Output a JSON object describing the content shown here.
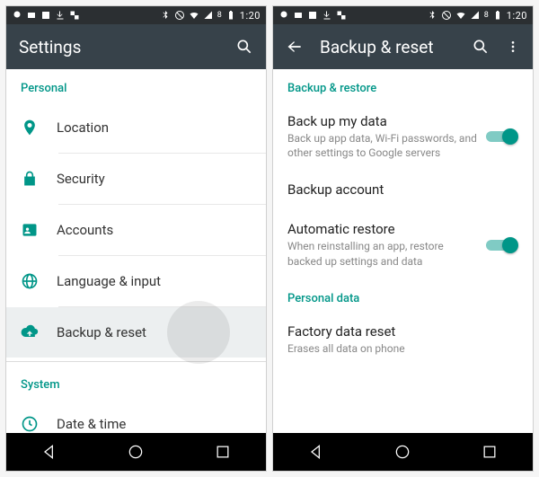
{
  "statusbar": {
    "time": "1:20",
    "battery_label": "8"
  },
  "left": {
    "appbar_title": "Settings",
    "section_personal": "Personal",
    "section_system": "System",
    "items": {
      "location": "Location",
      "security": "Security",
      "accounts": "Accounts",
      "language": "Language & input",
      "backup": "Backup & reset",
      "datetime": "Date & time"
    }
  },
  "right": {
    "appbar_title": "Backup & reset",
    "section_backup": "Backup & restore",
    "section_personal": "Personal data",
    "backup_data": {
      "title": "Back up my data",
      "sub": "Back up app data, Wi-Fi passwords, and other settings to Google servers"
    },
    "backup_account": {
      "title": "Backup account"
    },
    "auto_restore": {
      "title": "Automatic restore",
      "sub": "When reinstalling an app, restore backed up settings and data"
    },
    "factory_reset": {
      "title": "Factory data reset",
      "sub": "Erases all data on phone"
    }
  }
}
